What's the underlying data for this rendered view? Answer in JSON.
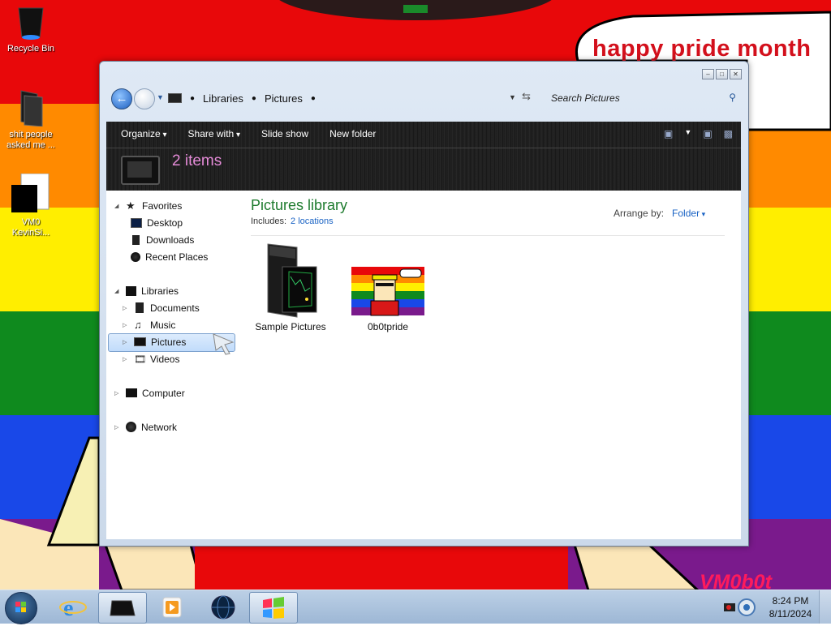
{
  "wallpaper": {
    "speech_text": "happy pride month",
    "signature": "VM0b0t",
    "colors": [
      "#e8080a",
      "#ff8a00",
      "#ffee00",
      "#0f8a1e",
      "#1948e8",
      "#7a1a8c"
    ]
  },
  "desktop": {
    "icons": [
      {
        "label": "Recycle Bin",
        "icon": "recycle-bin-icon"
      },
      {
        "label": "shit people asked me ...",
        "icon": "folder-icon"
      },
      {
        "label": "VM0 KevinSi...",
        "icon": "document-icon"
      }
    ]
  },
  "explorer": {
    "breadcrumb": [
      "Libraries",
      "Pictures"
    ],
    "search_placeholder": "Search Pictures",
    "toolbar": {
      "organize": "Organize",
      "share_with": "Share with",
      "slide_show": "Slide show",
      "new_folder": "New folder"
    },
    "items_count": "2 items",
    "nav": {
      "favorites": "Favorites",
      "favorites_items": [
        "Desktop",
        "Downloads",
        "Recent Places"
      ],
      "libraries": "Libraries",
      "libraries_items": [
        "Documents",
        "Music",
        "Pictures",
        "Videos"
      ],
      "computer": "Computer",
      "network": "Network",
      "selected": "Pictures"
    },
    "library_title": "Pictures library",
    "includes_label": "Includes:",
    "includes_link": "2 locations",
    "arrange_label": "Arrange by:",
    "arrange_value": "Folder",
    "files": [
      {
        "name": "Sample Pictures",
        "type": "folder"
      },
      {
        "name": "0b0tpride",
        "type": "image"
      }
    ]
  },
  "taskbar": {
    "time": "8:24 PM",
    "date": "8/11/2024",
    "pinned": [
      "internet-explorer-icon",
      "explorer-icon",
      "media-player-icon",
      "globe-icon",
      "windows-flag-icon"
    ]
  }
}
